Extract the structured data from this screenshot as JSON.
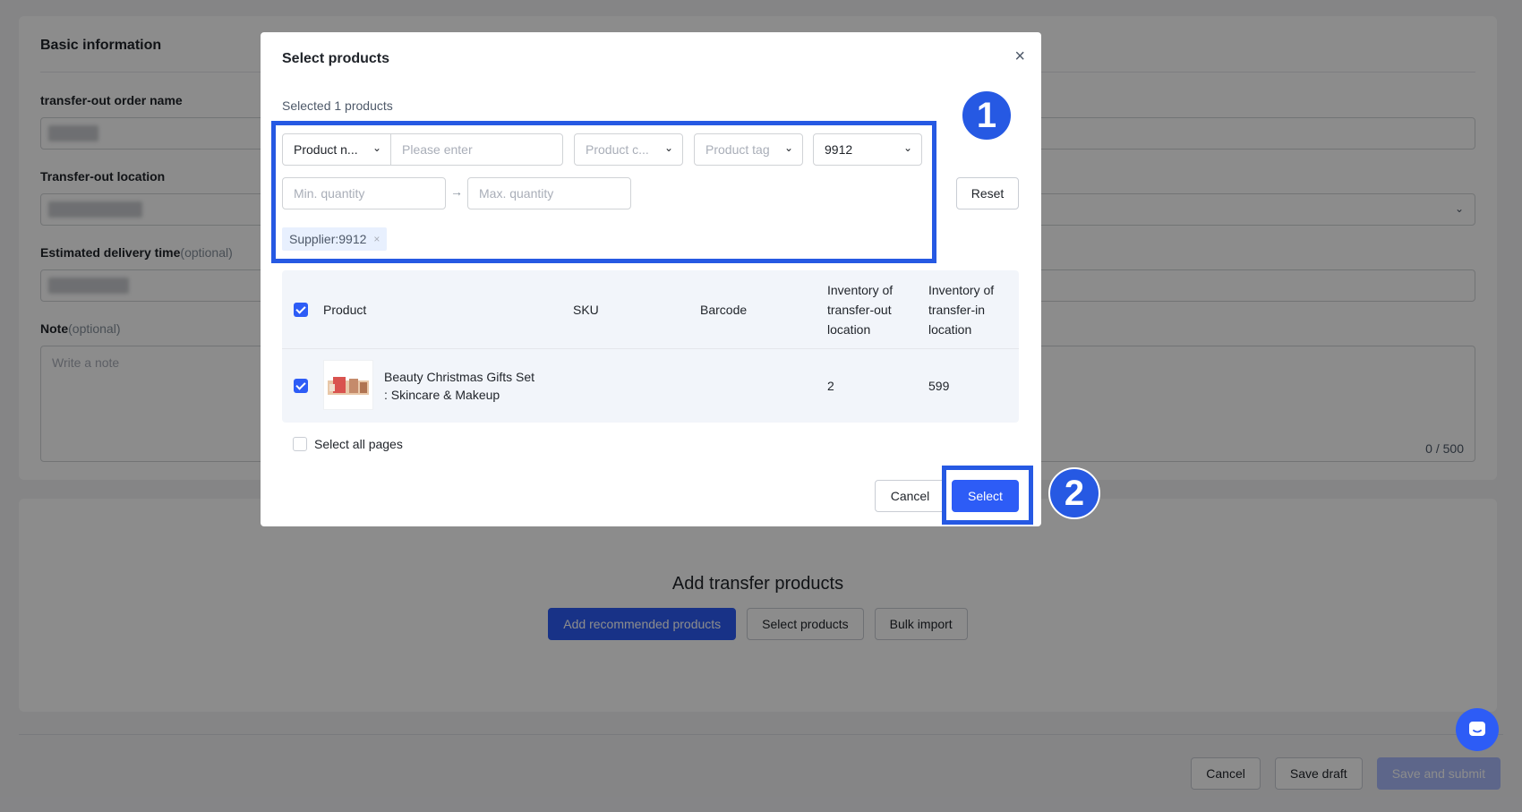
{
  "basic": {
    "section_title": "Basic information",
    "order_name_label": "transfer-out order name",
    "location_label": "Transfer-out location",
    "delivery_label": "Estimated delivery time",
    "delivery_optional": "(optional)",
    "note_label": "Note",
    "note_optional": "(optional)",
    "note_placeholder": "Write a note",
    "note_count": "0 / 500"
  },
  "transfer": {
    "title": "Add transfer products",
    "add_recommended": "Add recommended products",
    "select_products": "Select products",
    "bulk_import": "Bulk import"
  },
  "footer": {
    "cancel": "Cancel",
    "save_draft": "Save draft",
    "save_submit": "Save and submit"
  },
  "modal": {
    "title": "Select products",
    "close_icon": "×",
    "selected_count": "Selected 1 products",
    "filters": {
      "search_type": "Product n...",
      "search_placeholder": "Please enter",
      "category_placeholder": "Product c...",
      "tag_placeholder": "Product tag",
      "supplier_value": "9912",
      "min_qty_placeholder": "Min. quantity",
      "max_qty_placeholder": "Max. quantity",
      "range_arrow": "→",
      "reset": "Reset",
      "active_tag": "Supplier:9912",
      "tag_close": "×"
    },
    "table": {
      "headers": {
        "product": "Product",
        "sku": "SKU",
        "barcode": "Barcode",
        "inv_out_1": "Inventory of",
        "inv_out_2": "transfer-out",
        "inv_out_3": "location",
        "inv_in_1": "Inventory of",
        "inv_in_2": "transfer-in",
        "inv_in_3": "location"
      },
      "rows": [
        {
          "name_line1": "Beauty Christmas Gifts Set",
          "name_line2": ": Skincare & Makeup",
          "sku": "",
          "barcode": "",
          "inv_out": "2",
          "inv_in": "599",
          "checked": true
        }
      ]
    },
    "select_all_pages": "Select all pages",
    "cancel": "Cancel",
    "select": "Select"
  },
  "annotations": {
    "badge1": "1",
    "badge2": "2"
  },
  "colors": {
    "primary": "#2d5cf6",
    "annotation": "#2659e3",
    "overlay": "rgba(0,0,0,0.45)"
  }
}
